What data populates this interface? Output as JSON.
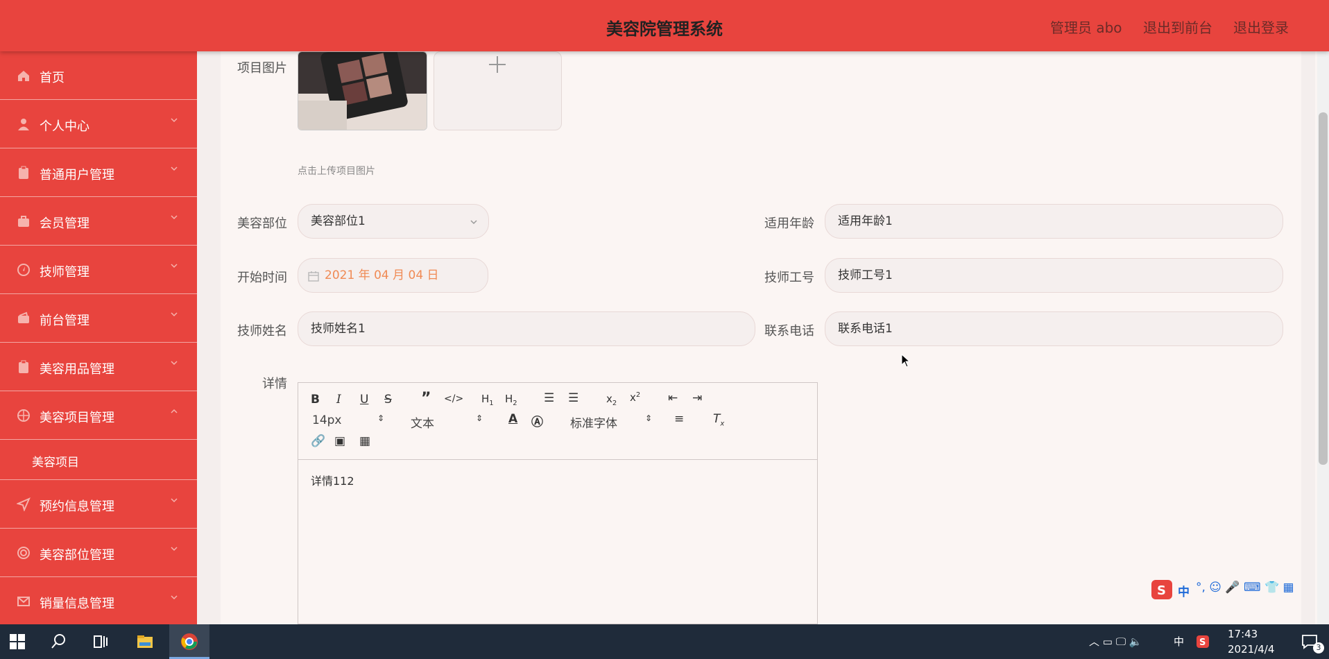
{
  "header": {
    "title": "美容院管理系统",
    "user": "管理员 abo",
    "front_link": "退出到前台",
    "logout": "退出登录"
  },
  "sidebar": {
    "items": [
      {
        "label": "首页",
        "icon": "home-icon"
      },
      {
        "label": "个人中心",
        "icon": "user-icon"
      },
      {
        "label": "普通用户管理",
        "icon": "clipboard-icon"
      },
      {
        "label": "会员管理",
        "icon": "briefcase-icon"
      },
      {
        "label": "技师管理",
        "icon": "compass-icon"
      },
      {
        "label": "前台管理",
        "icon": "wallet-icon"
      },
      {
        "label": "美容用品管理",
        "icon": "clipboard-icon"
      },
      {
        "label": "美容项目管理",
        "icon": "globe-icon"
      },
      {
        "label": "美容项目",
        "icon": ""
      },
      {
        "label": "预约信息管理",
        "icon": "send-icon"
      },
      {
        "label": "美容部位管理",
        "icon": "target-icon"
      },
      {
        "label": "销量信息管理",
        "icon": "mail-icon"
      }
    ]
  },
  "form": {
    "image_label": "项目图片",
    "upload_hint": "点击上传项目图片",
    "part_label": "美容部位",
    "part_value": "美容部位1",
    "age_label": "适用年龄",
    "age_value": "适用年龄1",
    "start_label": "开始时间",
    "start_value": "2021 年 04 月 04 日",
    "techid_label": "技师工号",
    "techid_value": "技师工号1",
    "techname_label": "技师姓名",
    "techname_value": "技师姓名1",
    "phone_label": "联系电话",
    "phone_value": "联系电话1",
    "detail_label": "详情"
  },
  "editor": {
    "font_size": "14px",
    "text_style": "文本",
    "font_family": "标准字体",
    "content": "详情112"
  },
  "taskbar": {
    "ime": "中",
    "time": "17:43",
    "date": "2021/4/4",
    "notif": "3"
  },
  "colors": {
    "brand": "#e8443e",
    "date_text": "#f08a54"
  }
}
